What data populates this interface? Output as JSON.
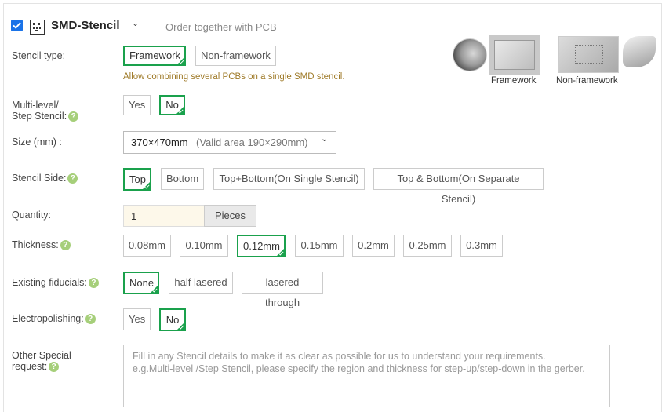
{
  "header": {
    "title": "SMD-Stencil",
    "subtitle": "Order together with PCB",
    "checked": true
  },
  "preview": {
    "framework_caption": "Framework",
    "nonframework_caption": "Non-framework"
  },
  "stencil_type": {
    "label": "Stencil type:",
    "options": [
      "Framework",
      "Non-framework"
    ],
    "selected": "Framework",
    "hint": "Allow combining several PCBs on a single SMD stencil."
  },
  "multi_level": {
    "label_line1": "Multi-level/",
    "label_line2": "Step Stencil:",
    "options": [
      "Yes",
      "No"
    ],
    "selected": "No"
  },
  "size": {
    "label": "Size (mm) :",
    "value": "370×470mm",
    "note": "(Valid area 190×290mm)"
  },
  "stencil_side": {
    "label": "Stencil Side:",
    "options": [
      "Top",
      "Bottom",
      "Top+Bottom(On Single Stencil)",
      "Top & Bottom(On Separate Stencil)"
    ],
    "selected": "Top"
  },
  "quantity": {
    "label": "Quantity:",
    "value": "1",
    "unit": "Pieces"
  },
  "thickness": {
    "label": "Thickness:",
    "options": [
      "0.08mm",
      "0.10mm",
      "0.12mm",
      "0.15mm",
      "0.2mm",
      "0.25mm",
      "0.3mm"
    ],
    "selected": "0.12mm"
  },
  "fiducials": {
    "label": "Existing fiducials:",
    "options": [
      "None",
      "half lasered",
      "lasered through"
    ],
    "selected": "None"
  },
  "electropolishing": {
    "label": "Electropolishing:",
    "options": [
      "Yes",
      "No"
    ],
    "selected": "No"
  },
  "special": {
    "label_line1": "Other Special",
    "label_line2": "request:",
    "placeholder": "Fill in any Stencil details to make it as clear as possible for us to understand your requirements.\ne.g.Multi-level /Step Stencil, please specify the region and thickness for step-up/step-down in the gerber."
  },
  "icons": {
    "help": "question-icon",
    "dropdown": "chevron-down-icon",
    "stencil": "stencil-icon"
  },
  "colors": {
    "selected_border": "#1aa14c",
    "hint_text": "#a07c2b",
    "help_icon": "#a6cf7a",
    "checkbox": "#1a73e8"
  }
}
